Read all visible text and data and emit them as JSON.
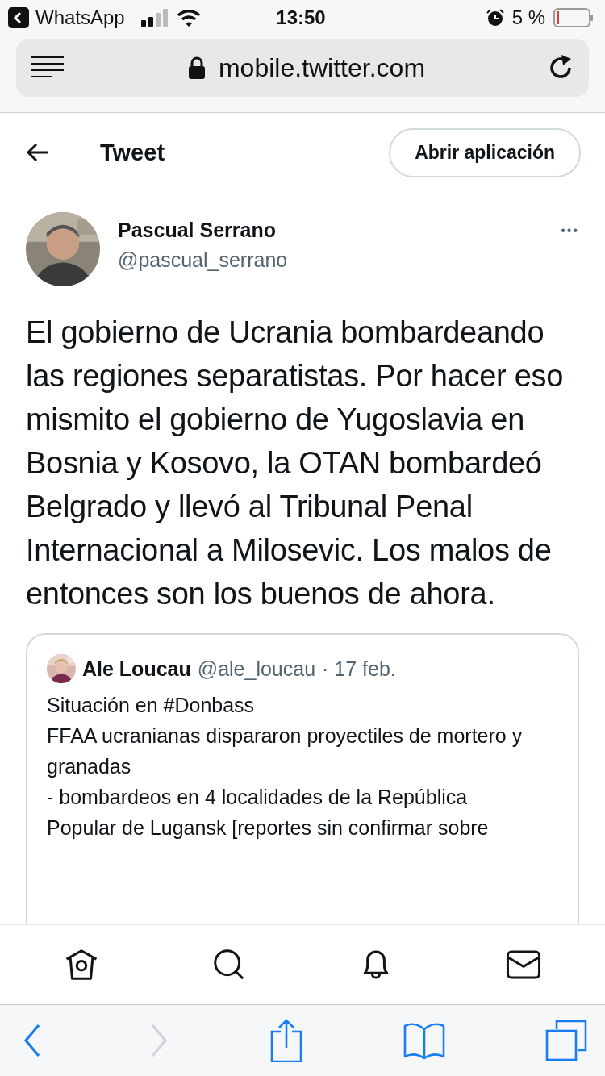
{
  "status_bar": {
    "back_app": "WhatsApp",
    "time": "13:50",
    "battery": "5 %"
  },
  "address_bar": {
    "url": "mobile.twitter.com"
  },
  "header": {
    "title": "Tweet",
    "open_app_button": "Abrir aplicación"
  },
  "tweet": {
    "author": "Pascual Serrano",
    "handle": "@pascual_serrano",
    "more": "•••",
    "text": "El gobierno de Ucrania bombardeando las regiones separatistas. Por hacer eso mismito el gobierno de Yugoslavia en Bosnia y Kosovo, la OTAN bombardeó Belgrado y llevó al Tribunal Penal Internacional a Milosevic. Los malos de entonces son los buenos de ahora.",
    "quoted": {
      "author": "Ale Loucau",
      "handle": "@ale_loucau",
      "date": "· 17 feb.",
      "text": "Situación en #Donbass\nFFAA ucranianas dispararon proyectiles de mortero y granadas\n- bombardeos en 4 localidades de la República Popular de Lugansk [reportes sin confirmar sobre"
    }
  },
  "tab_bar": [
    {
      "kind": "home"
    },
    {
      "kind": "search"
    },
    {
      "kind": "notifications"
    },
    {
      "kind": "messages"
    }
  ],
  "browser_toolbar": [
    {
      "kind": "back",
      "disabled": false
    },
    {
      "kind": "forward",
      "disabled": true
    },
    {
      "kind": "share",
      "disabled": false
    },
    {
      "kind": "bookmarks",
      "disabled": false
    },
    {
      "kind": "tabs",
      "disabled": false
    }
  ]
}
